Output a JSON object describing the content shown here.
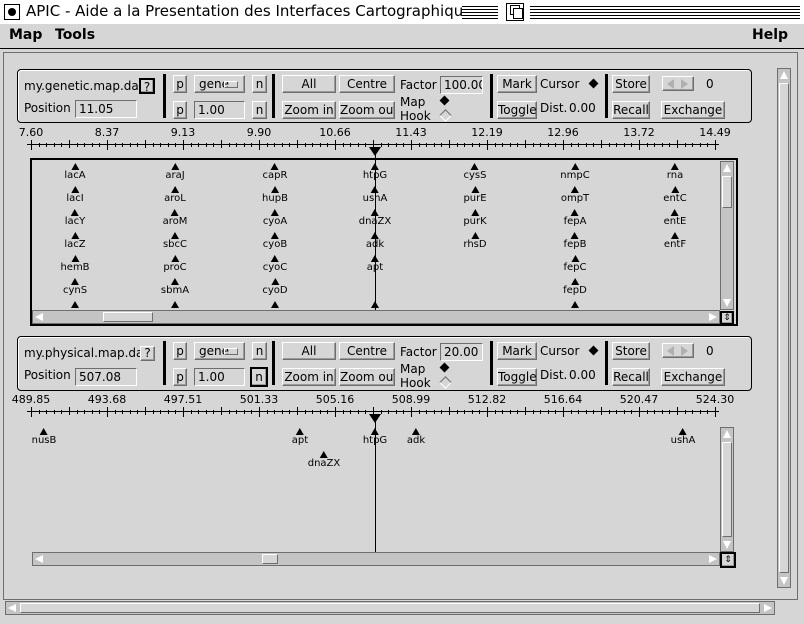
{
  "window": {
    "title": "APIC - Aide a la Presentation des Interfaces Cartographiques"
  },
  "menubar": {
    "map": "Map",
    "tools": "Tools",
    "help": "Help"
  },
  "panels": [
    {
      "file": "my.genetic.map.dat",
      "help": "?",
      "position_label": "Position",
      "position": "11.05",
      "p": "p",
      "n": "n",
      "select": "gene",
      "step": "1.00",
      "all": "All",
      "centre": "Centre",
      "zoom_in": "Zoom in",
      "zoom_out": "Zoom out",
      "factor_label": "Factor",
      "factor": "100.00",
      "map_label": "Map",
      "hook_label": "Hook",
      "mark": "Mark",
      "toggle": "Toggle",
      "cursor_label": "Cursor",
      "dist_label": "Dist.",
      "dist": "0.00",
      "store": "Store",
      "recall": "Recall",
      "exchange": "Exchange",
      "count": "0"
    },
    {
      "file": "my.physical.map.dat",
      "help": "?",
      "position_label": "Position",
      "position": "507.08",
      "p": "p",
      "n": "n",
      "select": "gene",
      "step": "1.00",
      "all": "All",
      "centre": "Centre",
      "zoom_in": "Zoom in",
      "zoom_out": "Zoom out",
      "factor_label": "Factor",
      "factor": "20.00",
      "map_label": "Map",
      "hook_label": "Hook",
      "mark": "Mark",
      "toggle": "Toggle",
      "cursor_label": "Cursor",
      "dist_label": "Dist.",
      "dist": "0.00",
      "store": "Store",
      "recall": "Recall",
      "exchange": "Exchange",
      "count": "0"
    }
  ],
  "genetic_axis": {
    "ticks": [
      "7.60",
      "8.37",
      "9.13",
      "9.90",
      "10.66",
      "11.43",
      "12.19",
      "12.96",
      "13.72",
      "14.49"
    ]
  },
  "physical_axis": {
    "ticks": [
      "489.85",
      "493.68",
      "497.51",
      "501.33",
      "505.16",
      "508.99",
      "512.82",
      "516.64",
      "520.47",
      "524.30"
    ]
  },
  "genetic_columns": [
    [
      "lacA",
      "lacI",
      "lacY",
      "lacZ",
      "hemB",
      "cynS"
    ],
    [
      "araJ",
      "aroL",
      "aroM",
      "sbcC",
      "proC",
      "sbmA"
    ],
    [
      "capR",
      "hupB",
      "cyoA",
      "cyoB",
      "cyoC",
      "cyoD"
    ],
    [
      "htpG",
      "ushA",
      "dnaZX",
      "adk",
      "apt"
    ],
    [
      "cysS",
      "purE",
      "purK",
      "rhsD"
    ],
    [
      "nmpC",
      "ompT",
      "fepA",
      "fepB",
      "fepC",
      "fepD"
    ],
    [
      "rna",
      "entC",
      "entE",
      "entF"
    ]
  ],
  "physical_genes": [
    {
      "name": "nusB",
      "row": 0
    },
    {
      "name": "apt",
      "row": 0
    },
    {
      "name": "dnaZX",
      "row": 1
    },
    {
      "name": "htpG",
      "row": 0
    },
    {
      "name": "adk",
      "row": 0
    },
    {
      "name": "ushA",
      "row": 0
    }
  ]
}
